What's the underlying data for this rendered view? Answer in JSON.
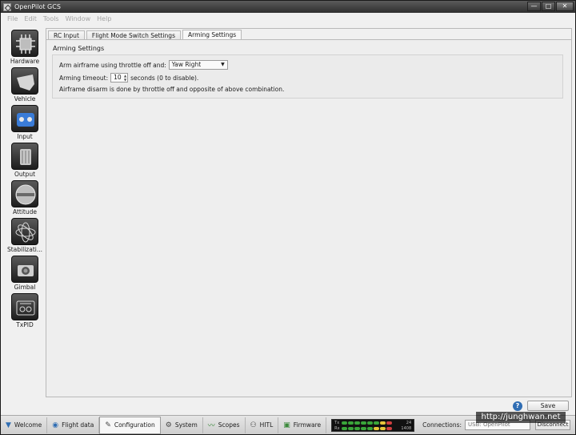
{
  "window": {
    "title": "OpenPilot GCS",
    "controls": [
      "—",
      "□",
      "✕"
    ]
  },
  "menu": [
    "File",
    "Edit",
    "Tools",
    "Window",
    "Help"
  ],
  "sidebar": [
    {
      "label": "Hardware",
      "icon": "chip-icon"
    },
    {
      "label": "Vehicle",
      "icon": "vehicle-icon"
    },
    {
      "label": "Input",
      "icon": "joystick-icon"
    },
    {
      "label": "Output",
      "icon": "motor-icon"
    },
    {
      "label": "Attitude",
      "icon": "horizon-icon"
    },
    {
      "label": "Stabilizati...",
      "icon": "gyro-icon"
    },
    {
      "label": "Gimbal",
      "icon": "camera-icon"
    },
    {
      "label": "TxPID",
      "icon": "transmitter-icon"
    }
  ],
  "tabs": [
    "RC Input",
    "Flight Mode Switch Settings",
    "Arming Settings"
  ],
  "arming": {
    "section_title": "Arming Settings",
    "arm_label": "Arm airframe using throttle off and:",
    "arm_value": "Yaw Right",
    "timeout_label": "Arming timeout:",
    "timeout_value": "10",
    "timeout_suffix": "seconds (0 to disable).",
    "disarm_note": "Airframe disarm is done by throttle off and opposite of above combination."
  },
  "footer": {
    "save_label": "Save",
    "help_symbol": "?"
  },
  "modes": [
    {
      "label": "Welcome",
      "icon": "welcome-icon"
    },
    {
      "label": "Flight data",
      "icon": "flight-data-icon"
    },
    {
      "label": "Configuration",
      "icon": "configuration-icon"
    },
    {
      "label": "System",
      "icon": "system-icon"
    },
    {
      "label": "Scopes",
      "icon": "scopes-icon"
    },
    {
      "label": "HITL",
      "icon": "hitl-icon"
    },
    {
      "label": "Firmware",
      "icon": "firmware-icon"
    }
  ],
  "telemetry": {
    "tx_label": "Tx",
    "rx_label": "Rx",
    "tx_value": "24",
    "rx_value": "1408"
  },
  "connections": {
    "label": "Connections:",
    "value": "USB: OpenPilot",
    "disconnect_label": "Disconnect"
  },
  "watermark": "http://junghwan.net",
  "colors": {
    "accent": "#2f6db3",
    "titlebar": "#3f3f3f",
    "panel": "#eeeeee"
  }
}
